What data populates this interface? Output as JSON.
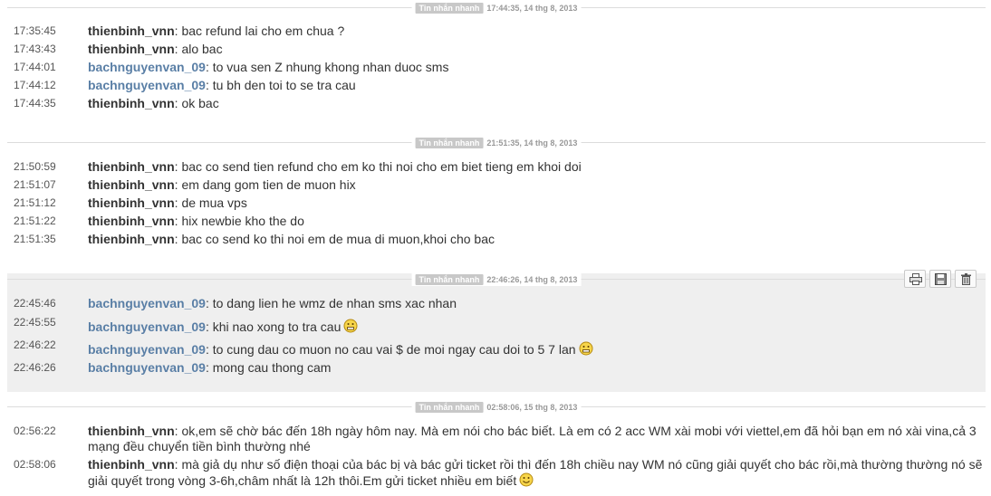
{
  "sessions": [
    {
      "tag": "Tin nhắn nhanh",
      "stamp": "17:44:35, 14 thg 8, 2013",
      "messages": [
        {
          "time": "17:35:45",
          "user": "thienbinh_vnn",
          "text": ": bac refund lai cho em chua ?"
        },
        {
          "time": "17:43:43",
          "user": "thienbinh_vnn",
          "text": ": alo bac"
        },
        {
          "time": "17:44:01",
          "user": "bachnguyenvan_09",
          "text": ": to vua sen Z nhung khong nhan duoc sms"
        },
        {
          "time": "17:44:12",
          "user": "bachnguyenvan_09",
          "text": ": tu bh den toi to se tra cau"
        },
        {
          "time": "17:44:35",
          "user": "thienbinh_vnn",
          "text": ": ok bac"
        }
      ]
    },
    {
      "tag": "Tin nhắn nhanh",
      "stamp": "21:51:35, 14 thg 8, 2013",
      "messages": [
        {
          "time": "21:50:59",
          "user": "thienbinh_vnn",
          "text": ": bac co send tien refund cho em ko thi noi cho em biet tieng em khoi doi"
        },
        {
          "time": "21:51:07",
          "user": "thienbinh_vnn",
          "text": ": em dang gom tien de muon hix"
        },
        {
          "time": "21:51:12",
          "user": "thienbinh_vnn",
          "text": ": de mua vps"
        },
        {
          "time": "21:51:22",
          "user": "thienbinh_vnn",
          "text": ": hix newbie kho the do"
        },
        {
          "time": "21:51:35",
          "user": "thienbinh_vnn",
          "text": ": bac co send ko thi noi em de mua di muon,khoi cho bac"
        }
      ]
    },
    {
      "tag": "Tin nhắn nhanh",
      "stamp": "22:46:26, 14 thg 8, 2013",
      "messages": [
        {
          "time": "22:45:46",
          "user": "bachnguyenvan_09",
          "text": ": to dang lien he wmz de nhan sms xac nhan"
        },
        {
          "time": "22:45:55",
          "user": "bachnguyenvan_09",
          "text": ": khi nao xong to tra cau"
        },
        {
          "time": "22:46:22",
          "user": "bachnguyenvan_09",
          "text": ": to cung dau co muon no cau vai $ de moi ngay cau doi to 5 7 lan"
        },
        {
          "time": "22:46:26",
          "user": "bachnguyenvan_09",
          "text": ": mong cau thong cam"
        }
      ]
    },
    {
      "tag": "Tin nhắn nhanh",
      "stamp": "02:58:06, 15 thg 8, 2013",
      "messages": [
        {
          "time": "02:56:22",
          "user": "thienbinh_vnn",
          "text": ": ok,em sẽ chờ bác đến 18h ngày hôm nay. Mà em nói cho bác biết. Là em có 2 acc WM xài mobi với viettel,em đã hỏi bạn em nó xài vina,cả 3 mạng đều chuyển tiền bình thường nhé"
        },
        {
          "time": "02:58:06",
          "user": "thienbinh_vnn",
          "text": ": mà giả dụ như số điện thoại của bác bị và bác gửi ticket rồi thì đến 18h chiều nay WM nó cũng giải quyết cho bác rồi,mà thường thường nó sẽ giải quyết trong vòng 3-6h,châm nhất là 12h thôi.Em gửi ticket nhiều em biết"
        }
      ]
    }
  ],
  "toolbar_icons": [
    "print-icon",
    "save-icon",
    "delete-icon"
  ],
  "colors": {
    "user_self": "#333333",
    "user_other": "#5a7fa6",
    "highlight_bg": "#efefef",
    "tag_bg": "#c8c8c8"
  }
}
